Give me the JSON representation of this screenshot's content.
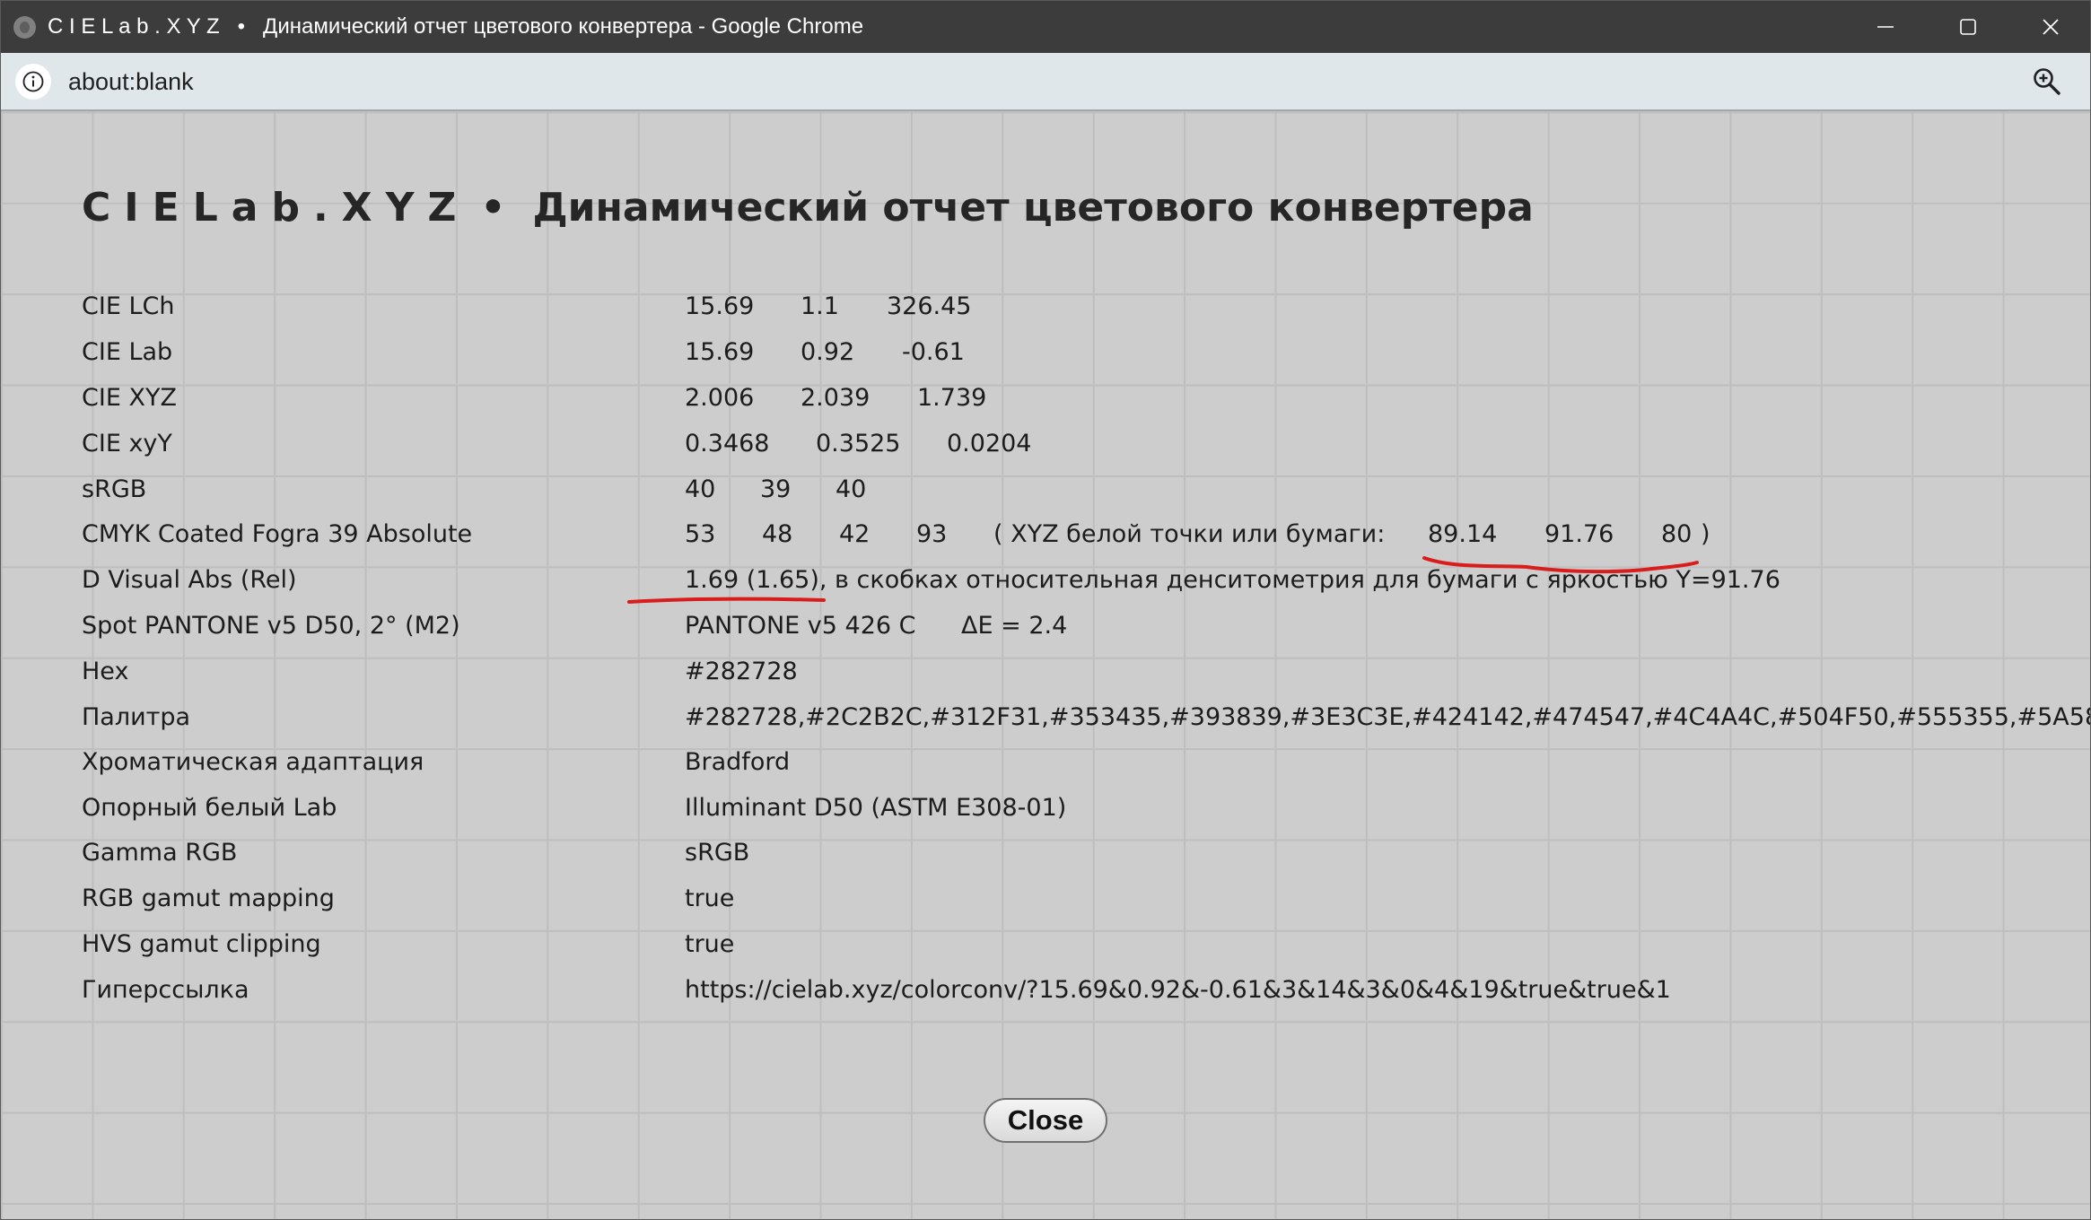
{
  "window": {
    "title": "C I E L a b . X Y Z   •   Динамический отчет цветового конвертера - Google Chrome",
    "app_icon": "globe-icon",
    "controls": [
      "minimize-icon",
      "maximize-icon",
      "close-icon"
    ]
  },
  "addressbar": {
    "url_scheme": "about:",
    "url_rest": "blank",
    "left_icon": "info-icon",
    "right_icon": "zoom-icon"
  },
  "report": {
    "brand": "CIELab.XYZ",
    "bullet": "•",
    "title": "Динамический отчет цветового конвертера",
    "rows": [
      {
        "label": "CIE LCh",
        "v1": "15.69",
        "v2": "1.1",
        "v3": "326.45"
      },
      {
        "label": "CIE Lab",
        "v1": "15.69",
        "v2": "0.92",
        "v3": "-0.61"
      },
      {
        "label": "CIE XYZ",
        "v1": "2.006",
        "v2": "2.039",
        "v3": "1.739"
      },
      {
        "label": "CIE xyY",
        "v1": "0.3468",
        "v2": "0.3525",
        "v3": "0.0204"
      },
      {
        "label": "sRGB",
        "v1": "40",
        "v2": "39",
        "v3": "40"
      },
      {
        "label": "CMYK Coated Fogra 39 Absolute",
        "c": "53",
        "m": "48",
        "y": "42",
        "k": "93",
        "paper_prefix": "( XYZ белой точки или бумаги:",
        "px": "89.14",
        "py": "91.76",
        "pz": "80",
        "paper_suffix": ")"
      },
      {
        "label": "D Visual Abs (Rel)",
        "density": "1.69 (1.65)",
        "note": ", в скобках относительная денситометрия для бумаги с яркостью Y=91.76"
      },
      {
        "label": "Spot PANTONE v5 D50, 2° (M2)",
        "spot": "PANTONE v5 426 C",
        "delta": "ΔE = 2.4"
      },
      {
        "label": "Hex",
        "value": "#282728"
      },
      {
        "label": "Палитра",
        "value": "#282728,#2C2B2C,#312F31,#353435,#393839,#3E3C3E,#424142,#474547,#4C4A4C,#504F50,#555355,#5A585"
      },
      {
        "label": "Хроматическая адаптация",
        "value": "Bradford"
      },
      {
        "label": "Опорный белый Lab",
        "value": "Illuminant D50 (ASTM E308-01)"
      },
      {
        "label": "Gamma RGB",
        "value": "sRGB"
      },
      {
        "label": "RGB gamut mapping",
        "value": "true"
      },
      {
        "label": "HVS gamut clipping",
        "value": "true"
      },
      {
        "label": "Гиперссылка",
        "value": "https://cielab.xyz/colorconv/?15.69&0.92&-0.61&3&14&3&0&4&19&true&true&1"
      }
    ],
    "close_label": "Close",
    "annotation_color": "#d91c1c"
  }
}
